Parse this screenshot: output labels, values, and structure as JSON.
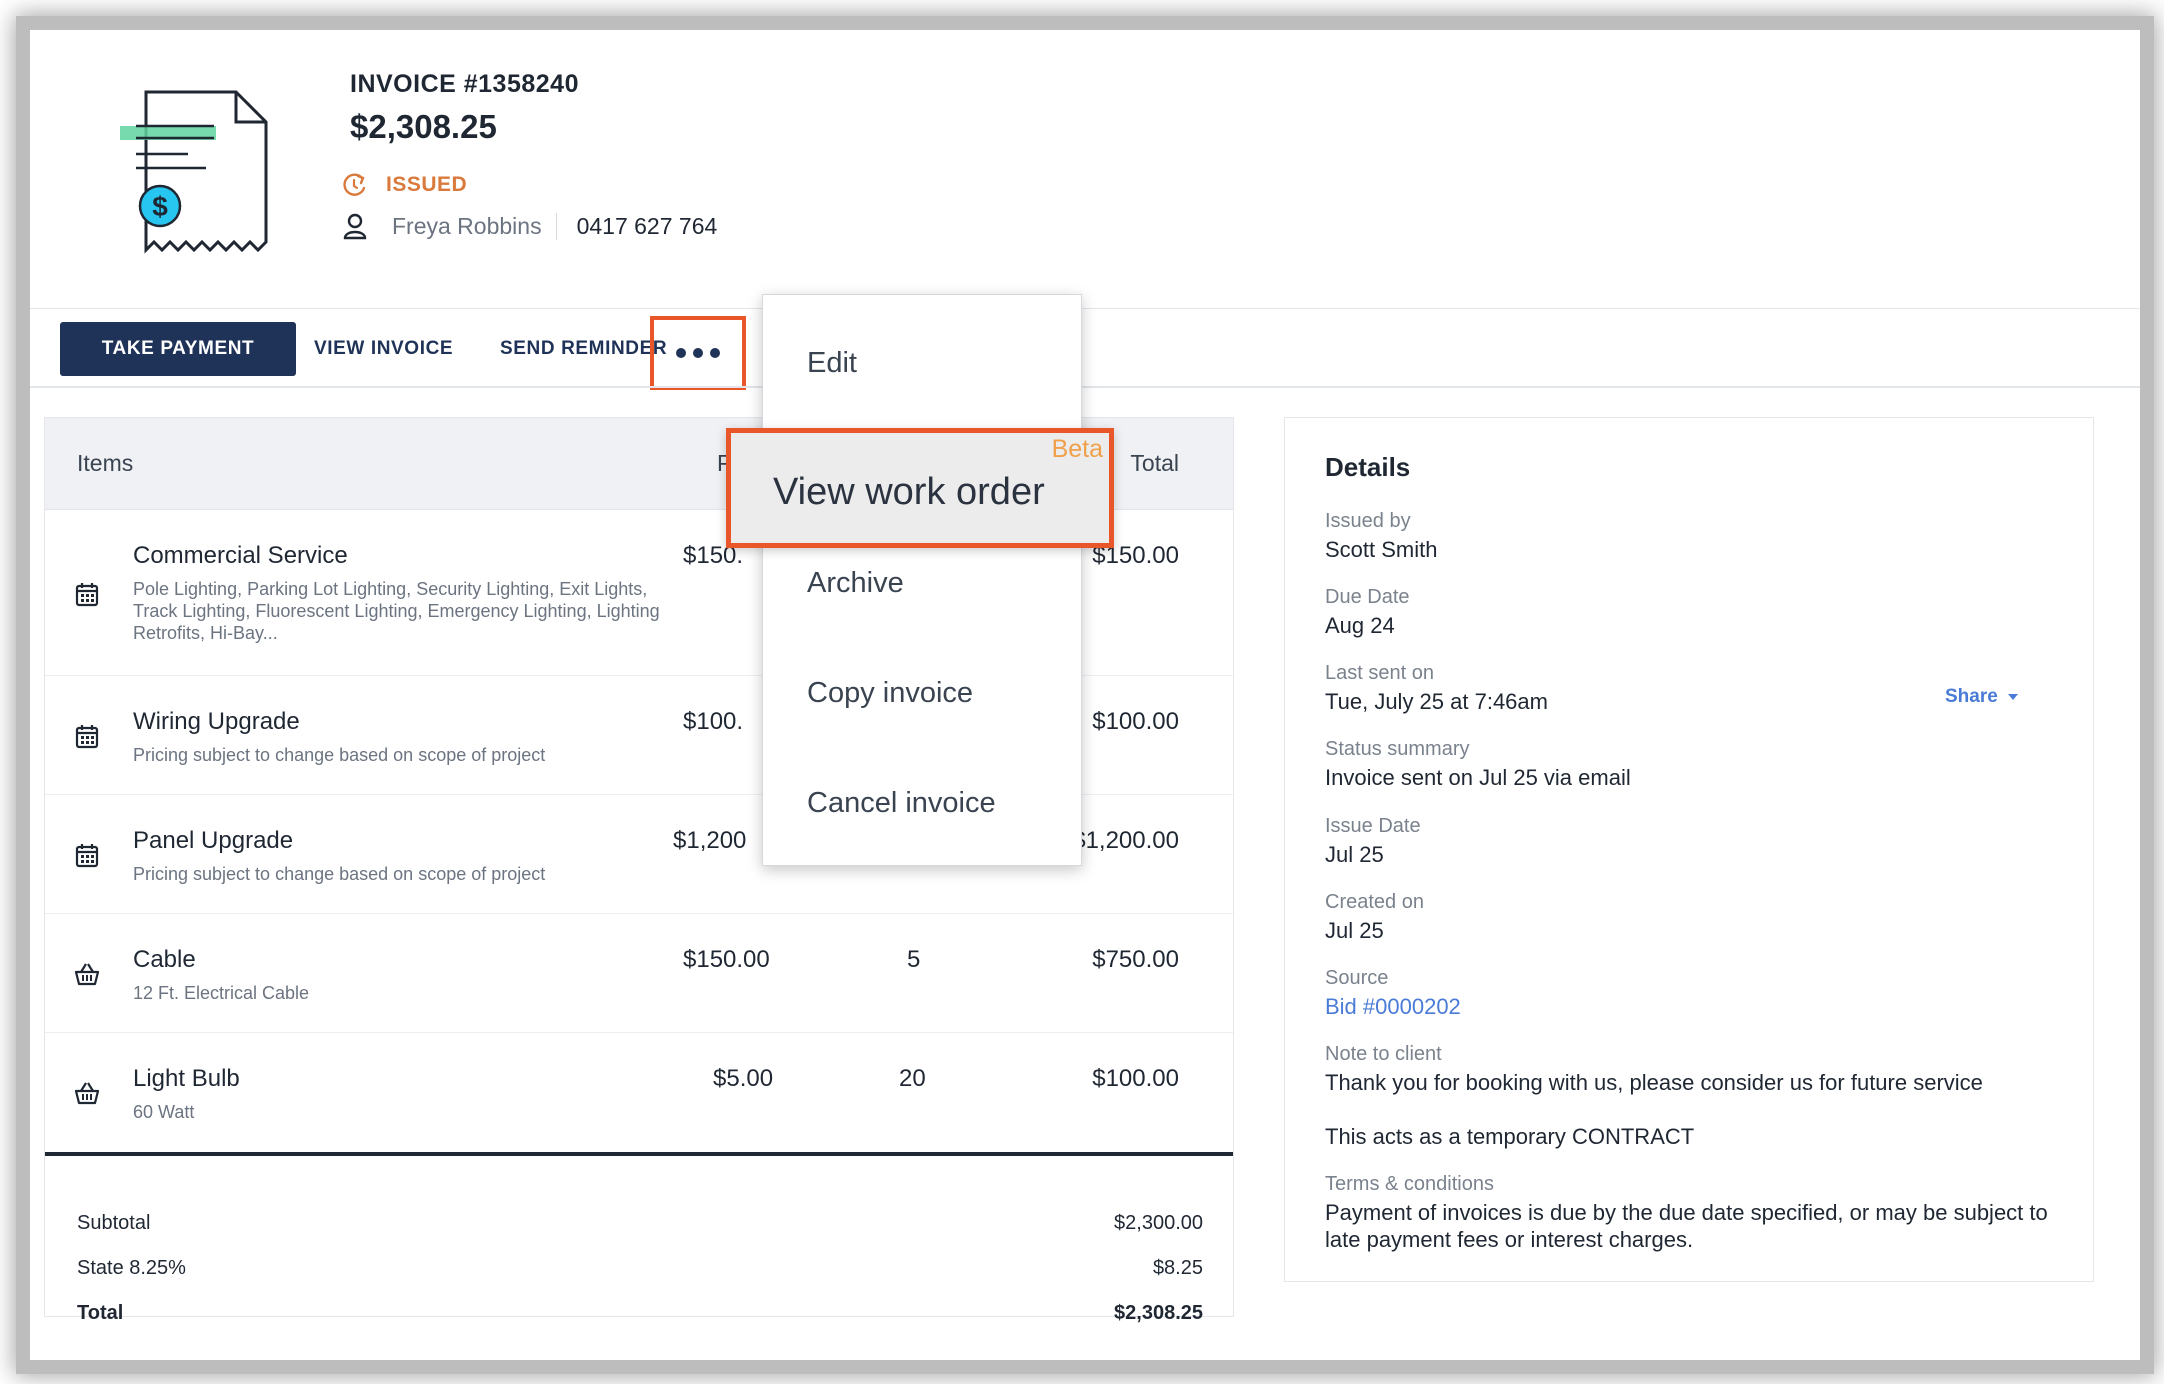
{
  "invoice": {
    "number": "INVOICE #1358240",
    "amount": "$2,308.25",
    "status": "ISSUED",
    "client_name": "Freya Robbins",
    "client_phone": "0417 627 764"
  },
  "toolbar": {
    "take_payment": "TAKE PAYMENT",
    "view_invoice": "VIEW INVOICE",
    "send_reminder": "SEND REMINDER"
  },
  "menu": {
    "items": [
      "Edit",
      "View work order",
      "Archive",
      "Copy invoice",
      "Cancel invoice"
    ],
    "beta_badge": "Beta"
  },
  "items_table": {
    "headers": {
      "items": "Items",
      "price": "P",
      "total": "Total"
    },
    "rows": [
      {
        "name": "Commercial Service",
        "description": "Pole Lighting, Parking Lot Lighting, Security Lighting, Exit Lights, Track Lighting, Fluorescent Lighting, Emergency Lighting, Lighting Retrofits, Hi-Bay...",
        "price": "$150.",
        "qty": "",
        "total": "$150.00",
        "icon": "calendar-icon"
      },
      {
        "name": "Wiring Upgrade",
        "description": "Pricing subject to change based on scope of project",
        "price": "$100.",
        "qty": "",
        "total": "$100.00",
        "icon": "calendar-icon"
      },
      {
        "name": "Panel Upgrade",
        "description": "Pricing subject to change based on scope of project",
        "price": "$1,200",
        "qty": "",
        "total": "$1,200.00",
        "icon": "calendar-icon"
      },
      {
        "name": "Cable",
        "description": "12 Ft. Electrical Cable",
        "price": "$150.00",
        "qty": "5",
        "total": "$750.00",
        "icon": "basket-icon"
      },
      {
        "name": "Light Bulb",
        "description": "60 Watt",
        "price": "$5.00",
        "qty": "20",
        "total": "$100.00",
        "icon": "basket-icon"
      }
    ],
    "summary": {
      "subtotal_label": "Subtotal",
      "subtotal": "$2,300.00",
      "tax_label": "State 8.25%",
      "tax": "$8.25",
      "total_label": "Total",
      "total": "$2,308.25"
    }
  },
  "details": {
    "title": "Details",
    "issued_by_label": "Issued by",
    "issued_by": "Scott Smith",
    "due_date_label": "Due Date",
    "due_date": "Aug 24",
    "last_sent_label": "Last sent on",
    "last_sent": "Tue, July 25 at 7:46am",
    "share": "Share",
    "status_summary_label": "Status summary",
    "status_summary": "Invoice sent on Jul 25 via email",
    "issue_date_label": "Issue Date",
    "issue_date": "Jul 25",
    "created_on_label": "Created on",
    "created_on": "Jul 25",
    "source_label": "Source",
    "source": "Bid #0000202",
    "note_label": "Note to client",
    "note_line1": "Thank you for booking with us, please consider us for future service",
    "note_line2": "This acts as a temporary CONTRACT",
    "terms_label": "Terms & conditions",
    "terms": "Payment of invoices is due by the due date specified, or may be subject to late payment fees or interest charges."
  },
  "colors": {
    "primary": "#1f3257",
    "accent_highlight": "#e8562a",
    "status": "#d97a3c",
    "link": "#4a7bd6",
    "beta": "#f0a04b"
  }
}
